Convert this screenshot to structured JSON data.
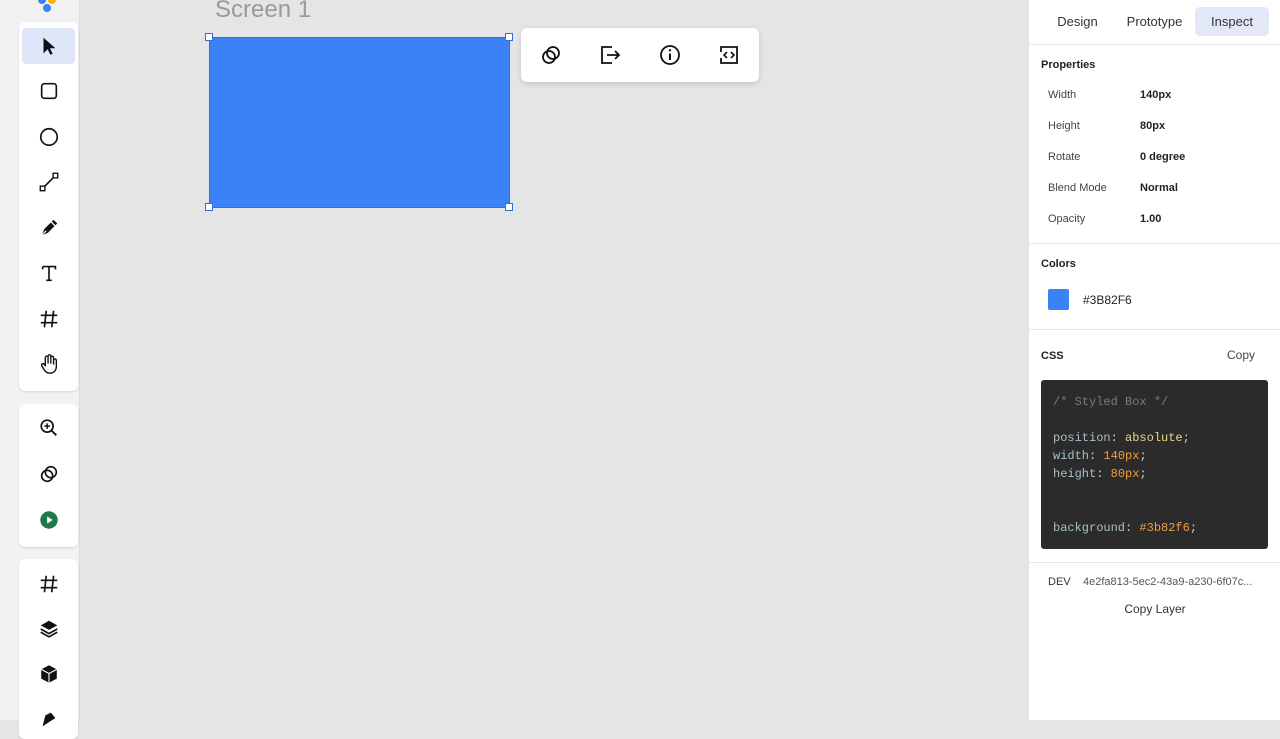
{
  "canvas": {
    "screen_label": "Screen 1",
    "selected_fill": "#3B82F6"
  },
  "left_toolbar": {
    "group1": [
      "select-cursor-icon",
      "rectangle-icon",
      "ellipse-icon",
      "line-icon",
      "pen-icon",
      "text-icon",
      "frame-hash-icon",
      "hand-icon"
    ],
    "group2": [
      "zoom-in-icon",
      "link-rings-icon",
      "play-icon"
    ],
    "group3": [
      "grid-hash-icon",
      "layers-icon",
      "component-box-icon",
      "more-tool-icon"
    ]
  },
  "floating_toolbar": {
    "icons": [
      "link-rings-icon",
      "export-icon",
      "info-icon",
      "code-icon"
    ]
  },
  "panel": {
    "tabs": [
      "Design",
      "Prototype",
      "Inspect"
    ],
    "active_tab": "Inspect",
    "properties_title": "Properties",
    "properties": [
      {
        "label": "Width",
        "value": "140px"
      },
      {
        "label": "Height",
        "value": "80px"
      },
      {
        "label": "Rotate",
        "value": "0 degree"
      },
      {
        "label": "Blend Mode",
        "value": "Normal"
      },
      {
        "label": "Opacity",
        "value": "1.00"
      }
    ],
    "colors_title": "Colors",
    "color_hex": "#3B82F6",
    "css_title": "CSS",
    "css_copy": "Copy",
    "code": {
      "comment": "/* Styled Box */",
      "lines": [
        {
          "prop": "position",
          "value": "absolute"
        },
        {
          "prop": "width",
          "value": "140px"
        },
        {
          "prop": "height",
          "value": "80px"
        },
        {
          "prop": "background",
          "value": "#3b82f6"
        }
      ]
    },
    "dev_label": "DEV",
    "dev_id": "4e2fa813-5ec2-43a9-a230-6f07c...",
    "copy_layer": "Copy Layer"
  }
}
